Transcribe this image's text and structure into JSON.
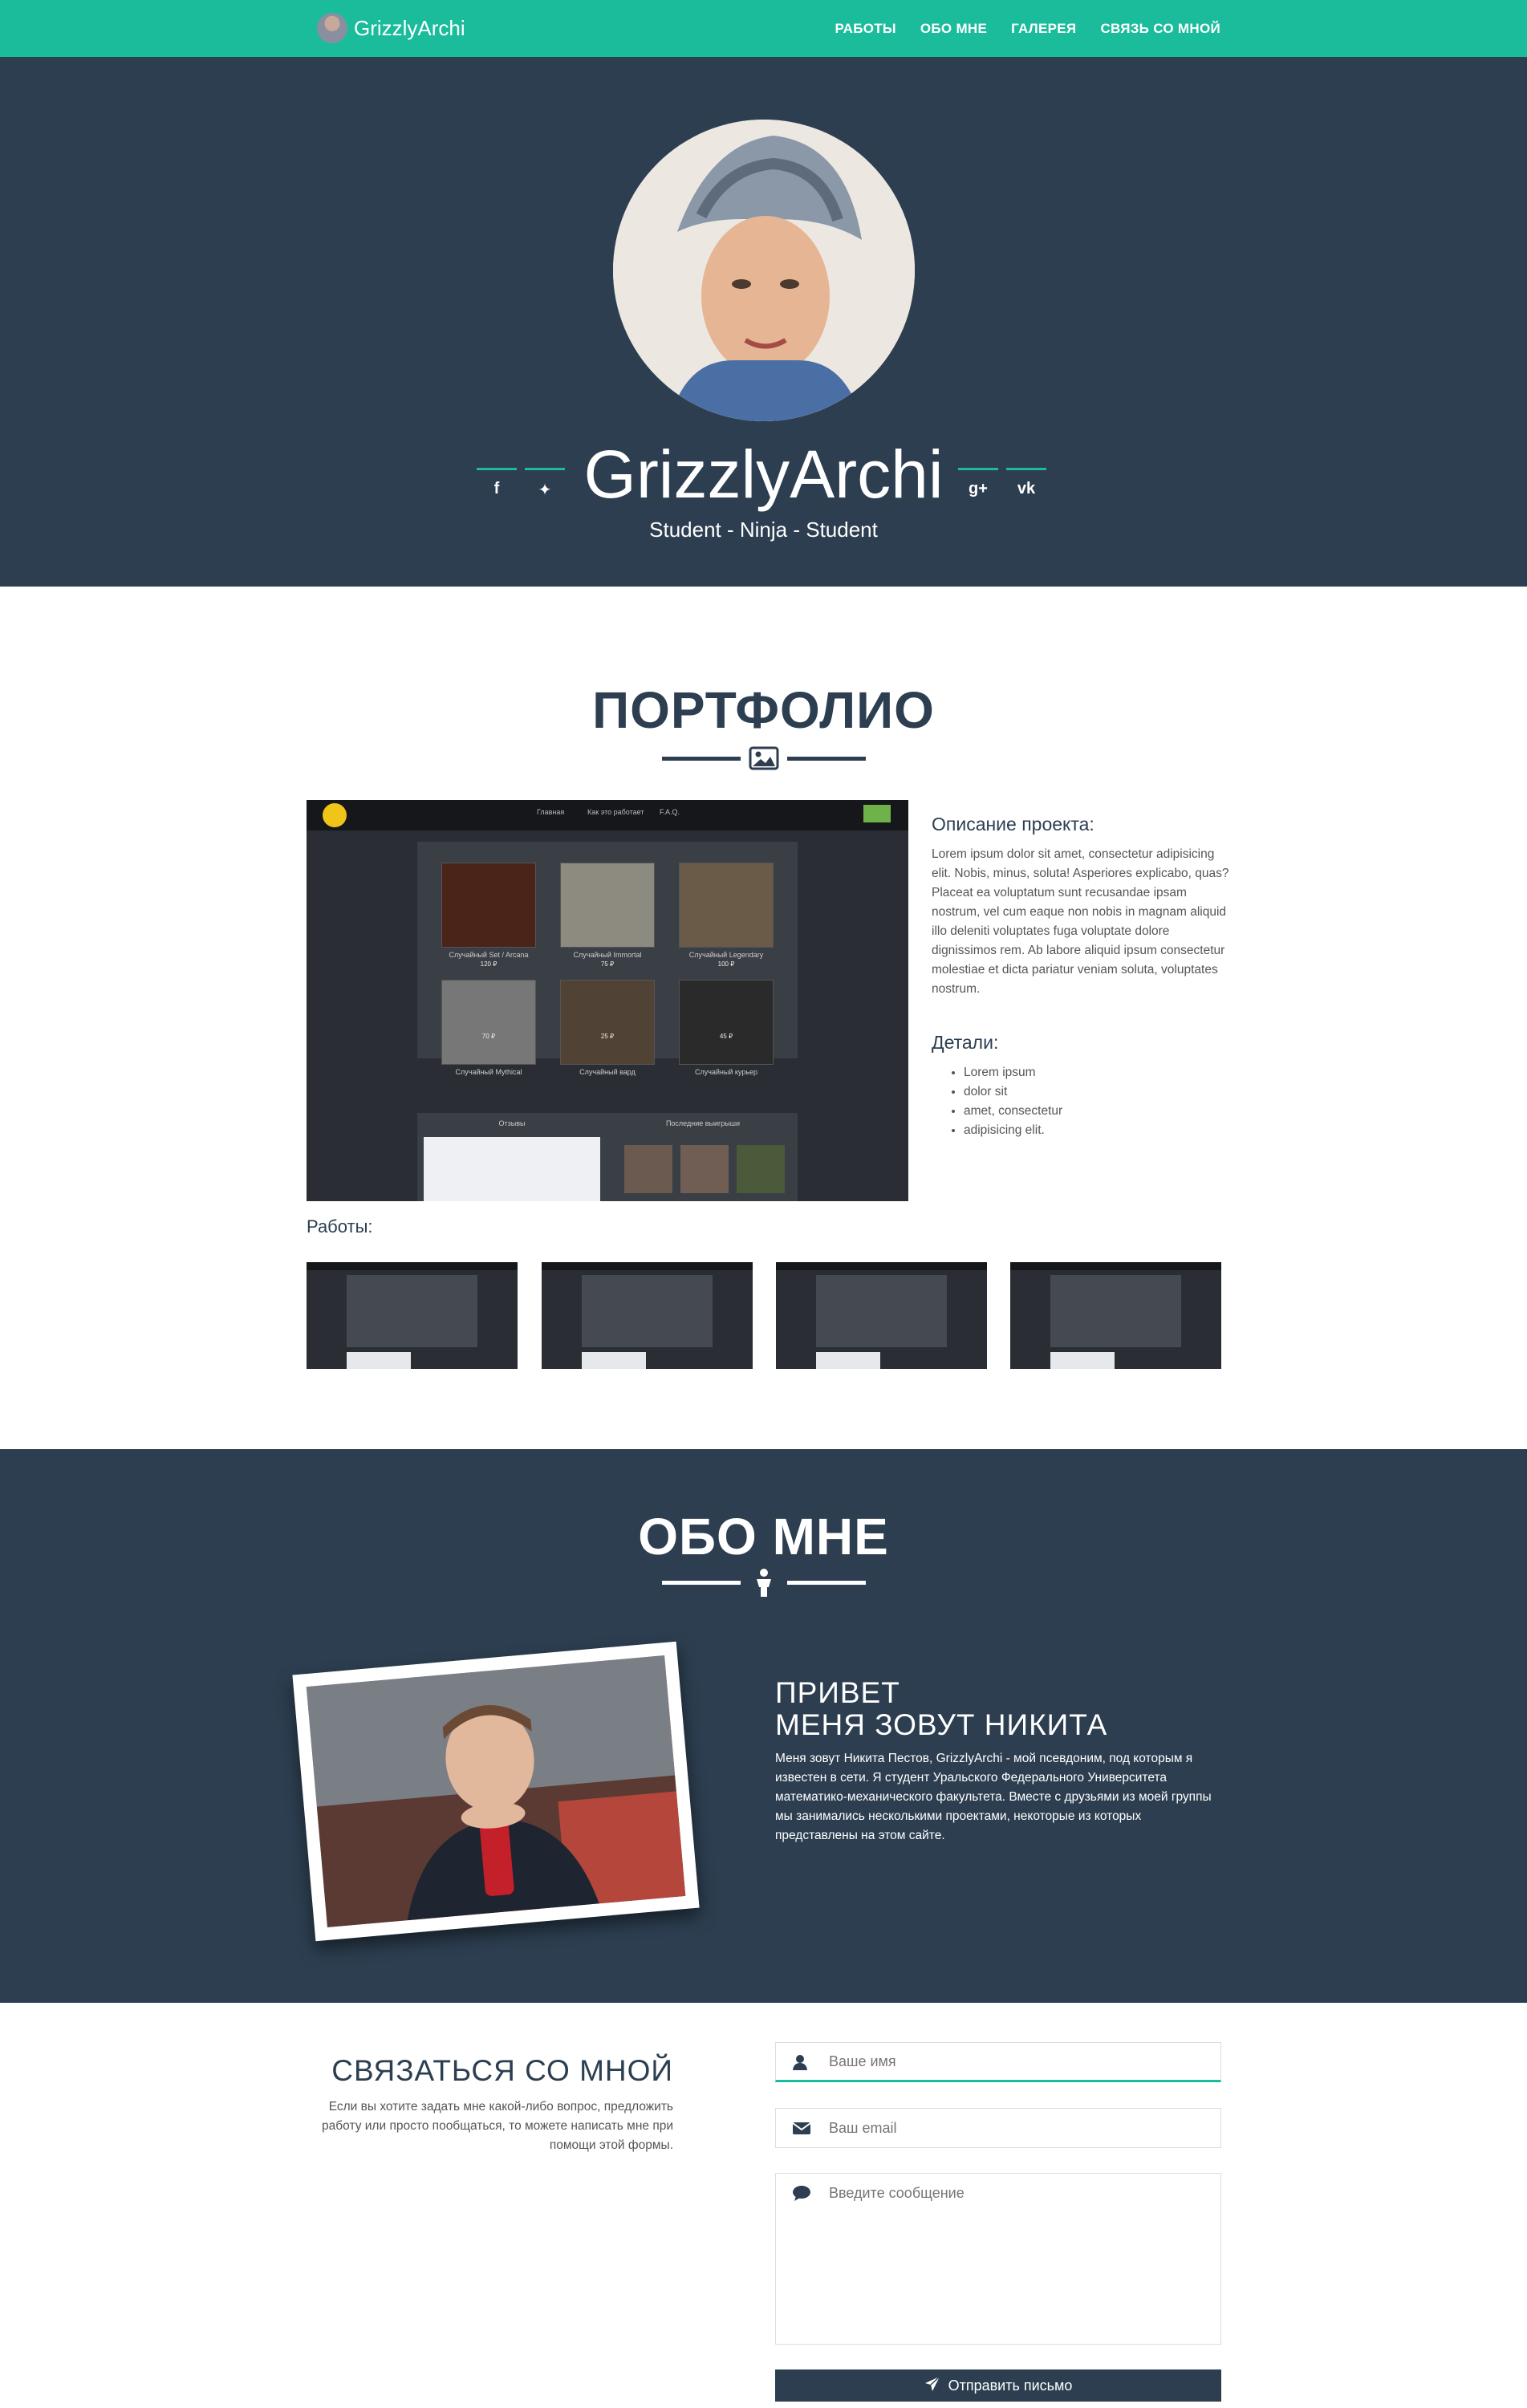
{
  "navbar": {
    "brand": "GrizzlyArchi",
    "links": [
      "РАБОТЫ",
      "ОБО МНЕ",
      "ГАЛЕРЕЯ",
      "СВЯЗЬ СО МНОЙ"
    ]
  },
  "header": {
    "name": "GrizzlyArchi",
    "subtitle": "Student - Ninja - Student",
    "social": [
      {
        "icon": "facebook-icon",
        "glyph": "f"
      },
      {
        "icon": "twitter-icon",
        "glyph": "✦"
      },
      {
        "icon": "google-plus-icon",
        "glyph": "g+"
      },
      {
        "icon": "vk-icon",
        "glyph": "vk"
      }
    ]
  },
  "portfolio": {
    "title": "ПОРТФОЛИО",
    "description_heading": "Описание проекта:",
    "description": "Lorem ipsum dolor sit amet, consectetur adipisicing elit. Nobis, minus, soluta! Asperiores explicabo, quas? Placeat ea voluptatum sunt recusandae ipsam nostrum, vel cum eaque non nobis in magnam aliquid illo deleniti voluptates fuga voluptate dolore dignissimos rem. Ab labore aliquid ipsum consectetur molestiae et dicta pariatur veniam soluta, voluptates nostrum.",
    "details_heading": "Детали:",
    "details": [
      "Lorem ipsum",
      "dolor sit",
      "amet, consectetur",
      "adipisicing elit."
    ],
    "works_label": "Работы:",
    "preview": {
      "nav": [
        "Главная",
        "Как это работает",
        "F.A.Q."
      ],
      "captions": [
        "Случайный Set / Arcana",
        "Случайный Immortal",
        "Случайный Legendary",
        "Случайный Mythical",
        "Случайный вард",
        "Случайный курьер"
      ],
      "prices": [
        "120 ₽",
        "75 ₽",
        "100 ₽",
        "70 ₽",
        "25 ₽",
        "45 ₽"
      ],
      "panels": [
        "Отзывы",
        "Последние выигрыши"
      ]
    }
  },
  "about": {
    "title": "ОБО МНЕ",
    "heading_line1": "ПРИВЕТ",
    "heading_line2": "МЕНЯ ЗОВУТ НИКИТА",
    "text": "Меня зовут Никита Пестов, GrizzlyArchi - мой псевдоним, под которым я известен в сети. Я студент Уральского Федерального Университета математико-механического факультета. Вместе с друзьями из моей группы мы занимались несколькими проектами, некоторые из которых представлены на этом сайте."
  },
  "contact": {
    "title": "СВЯЗАТЬСЯ СО МНОЙ",
    "text": "Если вы хотите задать мне какой-либо вопрос, предложить работу или просто пообщаться, то можете написать мне при помощи этой формы.",
    "name_placeholder": "Ваше имя",
    "email_placeholder": "Ваш email",
    "message_placeholder": "Введите сообщение",
    "submit_label": "Отправить письмо"
  },
  "colors": {
    "accent": "#1abc9c",
    "dark": "#2c3e50"
  }
}
